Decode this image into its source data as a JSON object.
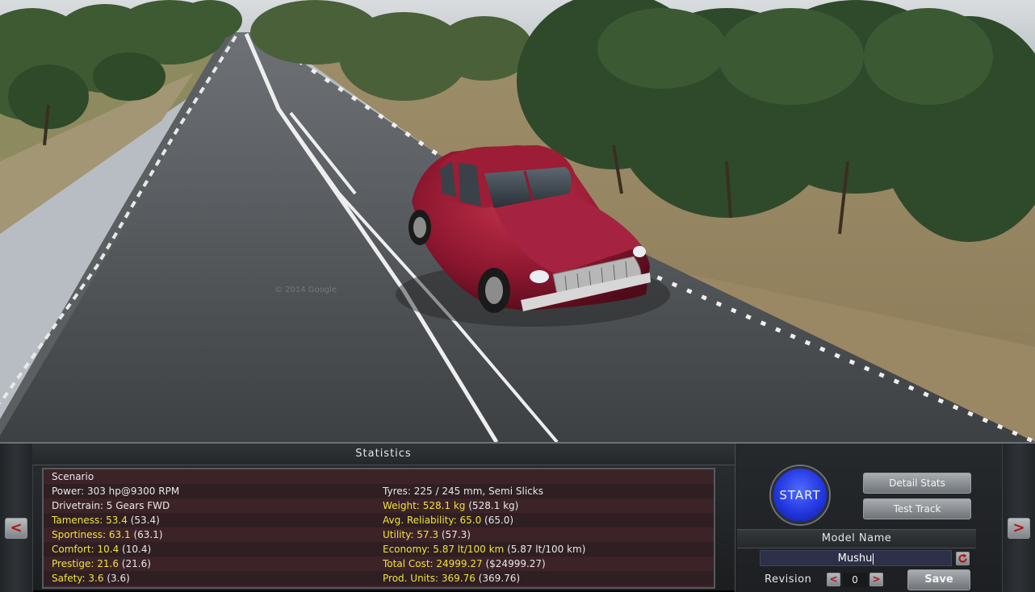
{
  "panel": {
    "title": "Statistics",
    "stats_rows": [
      {
        "left_label": "Scenario",
        "left_value": "",
        "left_paren": "",
        "right_label": "",
        "right_value": "",
        "right_paren": ""
      },
      {
        "left_label": "Power:",
        "left_value": "303 hp@9300 RPM",
        "left_paren": "",
        "right_label": "Tyres:",
        "right_value": "225 / 245 mm, Semi Slicks",
        "right_paren": ""
      },
      {
        "left_label": "Drivetrain:",
        "left_value": "5 Gears FWD",
        "left_paren": "",
        "right_label": "Weight:",
        "right_value": "528.1 kg",
        "right_paren": "(528.1 kg)"
      },
      {
        "left_label": "Tameness:",
        "left_value": "53.4",
        "left_paren": "(53.4)",
        "right_label": "Avg. Reliability:",
        "right_value": "65.0",
        "right_paren": "(65.0)"
      },
      {
        "left_label": "Sportiness:",
        "left_value": "63.1",
        "left_paren": "(63.1)",
        "right_label": "Utility:",
        "right_value": "57.3",
        "right_paren": "(57.3)"
      },
      {
        "left_label": "Comfort:",
        "left_value": "10.4",
        "left_paren": "(10.4)",
        "right_label": "Economy:",
        "right_value": "5.87 lt/100 km",
        "right_paren": "(5.87 lt/100 km)"
      },
      {
        "left_label": "Prestige:",
        "left_value": "21.6",
        "left_paren": "(21.6)",
        "right_label": "Total Cost:",
        "right_value": "24999.27",
        "right_paren": "($24999.27)"
      },
      {
        "left_label": "Safety:",
        "left_value": "3.6",
        "left_paren": "(3.6)",
        "right_label": "Prod. Units:",
        "right_value": "369.76",
        "right_paren": "(369.76)"
      }
    ]
  },
  "controls": {
    "start_label": "START",
    "detail_stats_label": "Detail Stats",
    "test_track_label": "Test Track",
    "model_name_header": "Model Name",
    "model_name_value": "Mushu",
    "revision_label": "Revision",
    "revision_value": "0",
    "rev_dec_label": "<",
    "rev_inc_label": ">",
    "save_label": "Save"
  },
  "nav": {
    "prev_label": "<",
    "next_label": ">"
  },
  "scene": {
    "watermark": "© 2014 Google"
  }
}
